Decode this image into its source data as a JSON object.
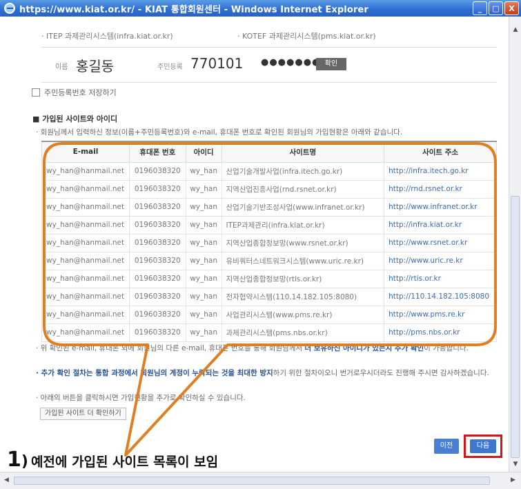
{
  "window": {
    "title": "https://www.kiat.or.kr/ - KIAT 통합회원센터 - Windows Internet Explorer",
    "buttons": {
      "minimize": "_",
      "maximize": "□",
      "close": "X"
    }
  },
  "systems_line": {
    "left": "· ITEP 과제관리시스템(infra.kiat.or.kr)",
    "right": "· KOTEF 과제관리시스템(pms.kiat.or.kr)"
  },
  "identity": {
    "name_label": "이름",
    "name_value": "홍길동",
    "birth_label": "주민등록",
    "birth_value": "770101",
    "password_mask": "●●●●●●●",
    "confirm_button": "확인"
  },
  "save_checkbox": {
    "label": "주민등록번호 저장하기",
    "checked": false
  },
  "section": {
    "title": "■ 가입된 사이트와 아이디",
    "description": "· 회원님께서 입력하신 정보(이름+주민등록번호)와 e-mail, 휴대폰 번호로 확인된 회원님의 가입현황은 아래와 같습니다."
  },
  "table": {
    "headers": [
      "E-mail",
      "휴대폰 번호",
      "아이디",
      "사이트명",
      "사이트 주소"
    ],
    "rows": [
      [
        "wy_han@hanmail.net",
        "0196038320",
        "wy_han",
        "산업기술개발사업(infra.itech.go.kr)",
        "http://infra.itech.go.kr"
      ],
      [
        "wy_han@hanmail.net",
        "0196038320",
        "wy_han",
        "지역산업진흥사업(rnd.rsnet.or.kr)",
        "http://rnd.rsnet.or.kr"
      ],
      [
        "wy_han@hanmail.net",
        "0196038320",
        "wy_han",
        "산업기술기반조성사업(www.infranet.or.kr)",
        "http://www.infranet.or.kr"
      ],
      [
        "wy_han@hanmail.net",
        "0196038320",
        "wy_han",
        "ITEP과제관리(infra.kiat.or.kr)",
        "http://infra.kiat.or.kr"
      ],
      [
        "wy_han@hanmail.net",
        "0196038320",
        "wy_han",
        "지역산업종합정보망(www.rsnet.or.kr)",
        "http://www.rsnet.or.kr"
      ],
      [
        "wy_han@hanmail.net",
        "0196038320",
        "wy_han",
        "유비쿼터스네트워크시스템(www.uric.re.kr)",
        "http://www.uric.re.kr"
      ],
      [
        "wy_han@hanmail.net",
        "0196038320",
        "wy_han",
        "지역산업종합정보망(rtis.or.kr)",
        "http://rtis.or.kr"
      ],
      [
        "wy_han@hanmail.net",
        "0196038320",
        "wy_han",
        "전자협약시스템(110.14.182.105:8080)",
        "http://110.14.182.105:8080"
      ],
      [
        "wy_han@hanmail.net",
        "0196038320",
        "wy_han",
        "사업관리시스템(www.pms.re.kr)",
        "http://www.pms.re.kr"
      ],
      [
        "wy_han@hanmail.net",
        "0196038320",
        "wy_han",
        "과제관리시스템(pms.nbs.or.kr)",
        "http://pms.nbs.or.kr"
      ]
    ]
  },
  "notes": {
    "note1_a": "· 위 확인된 e-mail, 휴대폰 외에 회원님의 다른 e-mail, 휴대폰 번호를 통해 회원님께서 ",
    "note1_b": "더 보유하신 아이디가 있는지 추가 확인",
    "note1_c": "이 가능합니다.",
    "note2_a": "· 추가 확인 절차는 통합 과정에서 회원님의 계정이 누락되는 것을 최대한 방지",
    "note2_b": "하기 위한 절차이오니 번거로우시더라도 진행해 주시면 감사하겠습니다.",
    "note3": "· 아래의 버튼을 클릭하시면 가입현황을 추가로 확인하실 수 있습니다.",
    "more_button": "가입된 사이트 더 확인하기"
  },
  "buttons": {
    "prev": "이전",
    "next": "다음"
  },
  "caption": {
    "number": "1",
    "paren": ")",
    "text": "예전에 가입된 사이트 목록이 보임"
  },
  "colors": {
    "highlight": "#e07f22",
    "next_frame": "#d5141a",
    "link": "#3a6bb4",
    "titlebar": "#2f6fd2"
  }
}
